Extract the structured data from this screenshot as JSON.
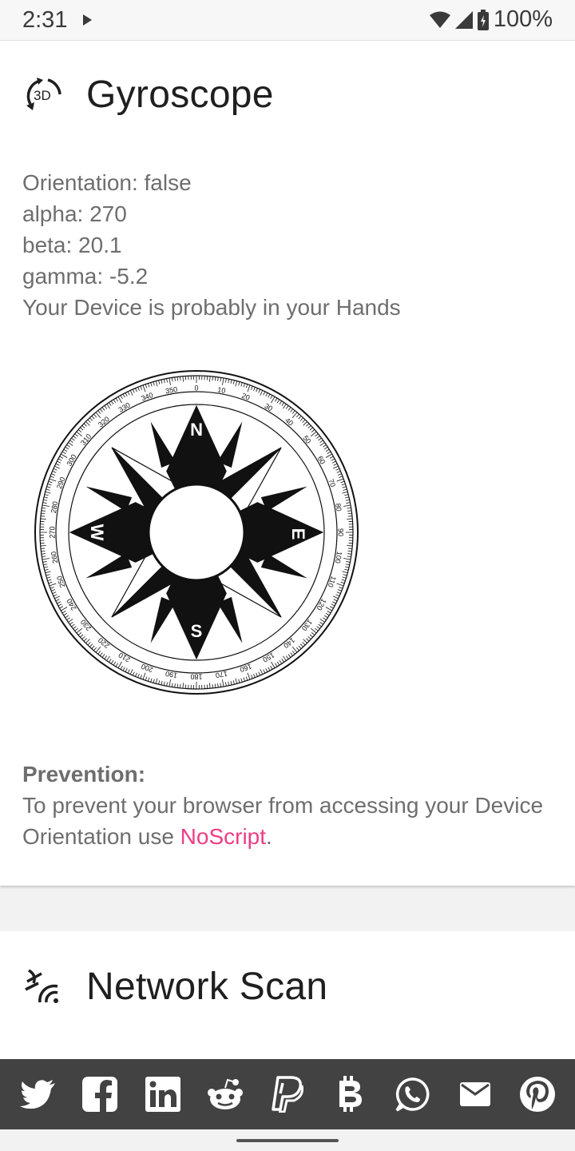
{
  "status_bar": {
    "time": "2:31",
    "battery": "100%"
  },
  "gyroscope_card": {
    "icon_text": "3D",
    "title": "Gyroscope",
    "orientation_line": "Orientation: false",
    "alpha_line": "alpha: 270",
    "beta_line": "beta: 20.1",
    "gamma_line": "gamma: -5.2",
    "status_line": "Your Device is probably in your Hands",
    "compass": {
      "cardinals": [
        "N",
        "E",
        "S",
        "W"
      ],
      "degree_labels": [
        "0",
        "10",
        "20",
        "30",
        "40",
        "50",
        "60",
        "70",
        "80",
        "90",
        "100",
        "110",
        "120",
        "130",
        "140",
        "150",
        "160",
        "170",
        "180",
        "190",
        "200",
        "210",
        "220",
        "230",
        "240",
        "250",
        "260",
        "270",
        "280",
        "290",
        "300",
        "310",
        "320",
        "330",
        "340",
        "350"
      ]
    },
    "prevention_heading": "Prevention:",
    "prevention_text": "To prevent your browser from accessing your Device Orientation use ",
    "prevention_link": "NoScript",
    "prevention_end": "."
  },
  "network_card": {
    "title": "Network Scan"
  },
  "share_bar": {
    "buttons": [
      "twitter-icon",
      "facebook-icon",
      "linkedin-icon",
      "reddit-icon",
      "paypal-icon",
      "bitcoin-icon",
      "whatsapp-icon",
      "mail-icon",
      "pinterest-icon"
    ]
  },
  "colors": {
    "link": "#ee3d85",
    "share_bar": "#424242",
    "body_text": "#6e6e6e"
  }
}
